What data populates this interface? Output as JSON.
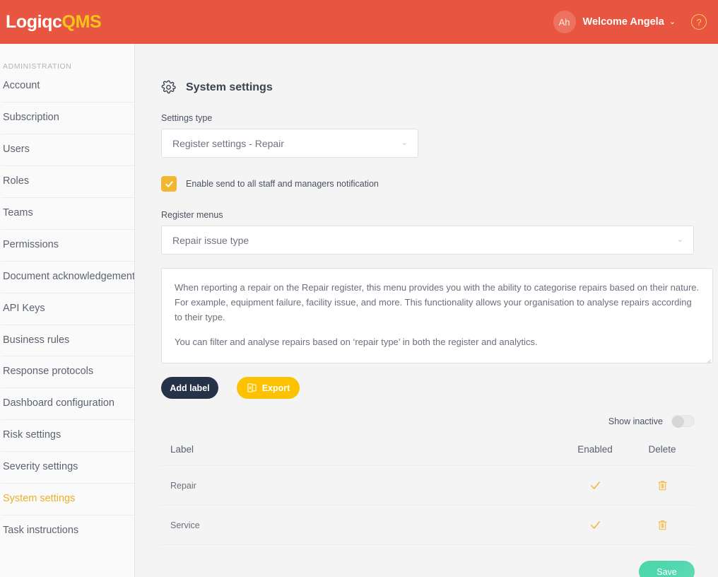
{
  "header": {
    "logo_primary": "Logiqc",
    "logo_accent": "QMS",
    "avatar_initials": "Ah",
    "welcome": "Welcome Angela",
    "chevron": "⌄",
    "help": "?",
    "bg_color": "#e85641",
    "accent_color": "#f5c518"
  },
  "sidebar": {
    "section_title": "ADMINISTRATION",
    "active_color": "#f0ae26",
    "items": [
      {
        "label": "Account",
        "active": false
      },
      {
        "label": "Subscription",
        "active": false
      },
      {
        "label": "Users",
        "active": false
      },
      {
        "label": "Roles",
        "active": false
      },
      {
        "label": "Teams",
        "active": false
      },
      {
        "label": "Permissions",
        "active": false
      },
      {
        "label": "Document acknowledgement",
        "active": false
      },
      {
        "label": "API Keys",
        "active": false
      },
      {
        "label": "Business rules",
        "active": false
      },
      {
        "label": "Response protocols",
        "active": false
      },
      {
        "label": "Dashboard configuration",
        "active": false
      },
      {
        "label": "Risk settings",
        "active": false
      },
      {
        "label": "Severity settings",
        "active": false
      },
      {
        "label": "System settings",
        "active": true
      },
      {
        "label": "Task instructions",
        "active": false
      }
    ]
  },
  "main": {
    "page_title": "System settings",
    "settings_type": {
      "label": "Settings type",
      "value": "Register settings - Repair",
      "chevron": "⌄"
    },
    "notification_checkbox": {
      "label": "Enable send to all staff and managers notification",
      "checked": true,
      "color": "#f2b731"
    },
    "register_menus": {
      "label": "Register menus",
      "value": "Repair issue type",
      "chevron": "⌄"
    },
    "description": {
      "paragraph_1": "When reporting a repair on the Repair register, this menu provides you with the ability to categorise repairs based on their nature. For example, equipment failure, facility issue, and more. This functionality allows your organisation to analyse repairs according to their type.",
      "paragraph_2": "You can filter and analyse repairs based on ‘repair type’ in both the register and analytics."
    },
    "buttons": {
      "add_label": "Add label",
      "export": "Export",
      "export_icon": "excel-file-icon",
      "save": "Save",
      "add_label_color": "#263248",
      "export_color": "#fcc200",
      "save_color": "#4cd7a6"
    },
    "show_inactive": {
      "label": "Show inactive",
      "enabled": false
    },
    "table": {
      "columns": [
        "Label",
        "Enabled",
        "Delete"
      ],
      "rows": [
        {
          "label": "Repair",
          "enabled": true,
          "delete_icon": "trash-icon"
        },
        {
          "label": "Service",
          "enabled": true,
          "delete_icon": "trash-icon"
        }
      ],
      "icon_color": "#f5b335"
    }
  }
}
